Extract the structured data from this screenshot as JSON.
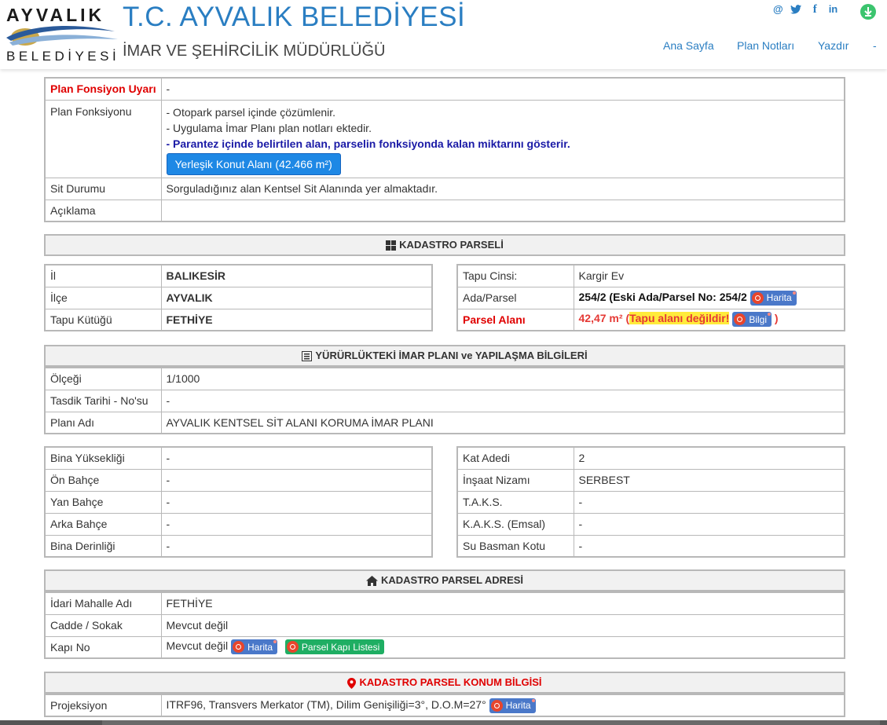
{
  "header": {
    "logo_top": "AYVALIK",
    "logo_bottom": "BELEDİYESİ",
    "title": "T.C. AYVALIK BELEDİYESİ",
    "subtitle": "İMAR VE ŞEHİRCİLİK MÜDÜRLÜĞÜ",
    "social": {
      "email": "@",
      "twitter": "twitter",
      "facebook": "f",
      "linkedin": "in"
    },
    "nav": [
      "Ana Sayfa",
      "Plan Notları",
      "Yazdır",
      "-"
    ]
  },
  "plan": {
    "uyari_label": "Plan Fonsiyon Uyarı",
    "uyari_value": "-",
    "fonksiyon_label": "Plan Fonksiyonu",
    "fonksiyon_line1": "- Otopark parsel içinde çözümlenir.",
    "fonksiyon_line2": "- Uygulama İmar Planı plan notları ektedir.",
    "fonksiyon_line3": "- Parantez içinde belirtilen alan, parselin fonksiyonda kalan miktarını gösterir.",
    "fonksiyon_button": "Yerleşik Konut Alanı (42.466 m²)",
    "sit_label": "Sit Durumu",
    "sit_value": "Sorguladığınız alan Kentsel Sit Alanında yer almaktadır.",
    "aciklama_label": "Açıklama",
    "aciklama_value": ""
  },
  "kadastro": {
    "heading": "KADASTRO PARSELİ",
    "left": [
      {
        "label": "İl",
        "value": "BALIKESİR"
      },
      {
        "label": "İlçe",
        "value": "AYVALIK"
      },
      {
        "label": "Tapu Kütüğü",
        "value": "FETHİYE"
      }
    ],
    "tapu_cinsi_label": "Tapu Cinsi:",
    "tapu_cinsi_value": "Kargir Ev",
    "ada_label": "Ada/Parsel",
    "ada_value": "254/2 (Eski Ada/Parsel No: 254/2",
    "harita": "Harita",
    "parsel_alani_label": "Parsel Alanı",
    "parsel_alani_value": "42,47 m²",
    "parsel_alani_open": "(",
    "tapu_warning": "Tapu alanı değildir!",
    "bilgi": "Bilgi",
    "parsel_alani_close": ")"
  },
  "imar": {
    "heading": "YÜRÜRLÜKTEKİ İMAR PLANI ve YAPILAŞMA BİLGİLERİ",
    "rows": [
      {
        "label": "Ölçeği",
        "value": "1/1000"
      },
      {
        "label": "Tasdik Tarihi - No'su",
        "value": "-"
      },
      {
        "label": "Planı Adı",
        "value": "AYVALIK KENTSEL SİT ALANI KORUMA İMAR PLANI"
      }
    ]
  },
  "yapilasma": {
    "left": [
      {
        "label": "Bina Yüksekliği",
        "value": "-"
      },
      {
        "label": "Ön Bahçe",
        "value": "-"
      },
      {
        "label": "Yan Bahçe",
        "value": "-"
      },
      {
        "label": "Arka Bahçe",
        "value": "-"
      },
      {
        "label": "Bina Derinliği",
        "value": "-"
      }
    ],
    "right": [
      {
        "label": "Kat Adedi",
        "value": "2"
      },
      {
        "label": "İnşaat Nizamı",
        "value": "SERBEST"
      },
      {
        "label": "T.A.K.S.",
        "value": "-"
      },
      {
        "label": "K.A.K.S. (Emsal)",
        "value": "-"
      },
      {
        "label": "Su Basman Kotu",
        "value": "-"
      }
    ]
  },
  "adres": {
    "heading": "KADASTRO PARSEL ADRESİ",
    "mahalle_label": "İdari Mahalle Adı",
    "mahalle_value": "FETHİYE",
    "cadde_label": "Cadde / Sokak",
    "cadde_value": "Mevcut değil",
    "kapi_label": "Kapı No",
    "kapi_value": "Mevcut değil",
    "harita": "Harita",
    "kapi_listesi": "Parsel Kapı Listesi"
  },
  "konum": {
    "heading": "KADASTRO PARSEL KONUM BİLGİSİ",
    "projeksiyon_label": "Projeksiyon",
    "projeksiyon_value": "ITRF96, Transvers Merkator (TM), Dilim Genişiliği=3°, D.O.M=27°",
    "harita": "Harita"
  },
  "colors": {
    "accent": "#2a7ec2",
    "warning": "#e00000",
    "highlight": "#ffeb3b",
    "button": "#1e88e5"
  }
}
